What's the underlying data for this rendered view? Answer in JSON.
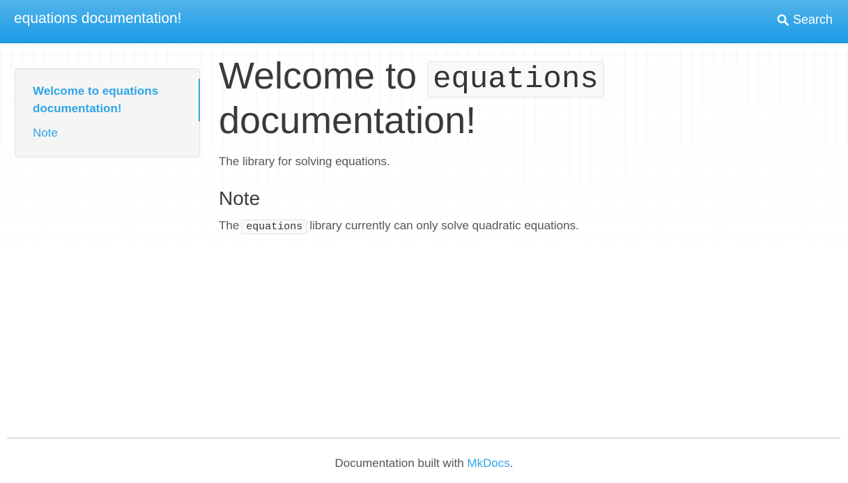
{
  "navbar": {
    "brand": "equations documentation!",
    "search_label": "Search",
    "search_icon": "search-icon"
  },
  "sidebar": {
    "items": [
      {
        "label": "Welcome to equations documentation!",
        "active": true
      },
      {
        "label": "Note",
        "active": false
      }
    ]
  },
  "main": {
    "title_prefix": "Welcome to",
    "title_code": "equations",
    "title_suffix": "documentation!",
    "lead": "The library for solving equations.",
    "section_heading": "Note",
    "note_before": "The",
    "note_code": "equations",
    "note_after": "library currently can only solve quadratic equations."
  },
  "footer": {
    "text_before": "Documentation built with",
    "link": "MkDocs",
    "text_after": "."
  },
  "colors": {
    "accent": "#2fa4e7",
    "text": "#404040"
  }
}
